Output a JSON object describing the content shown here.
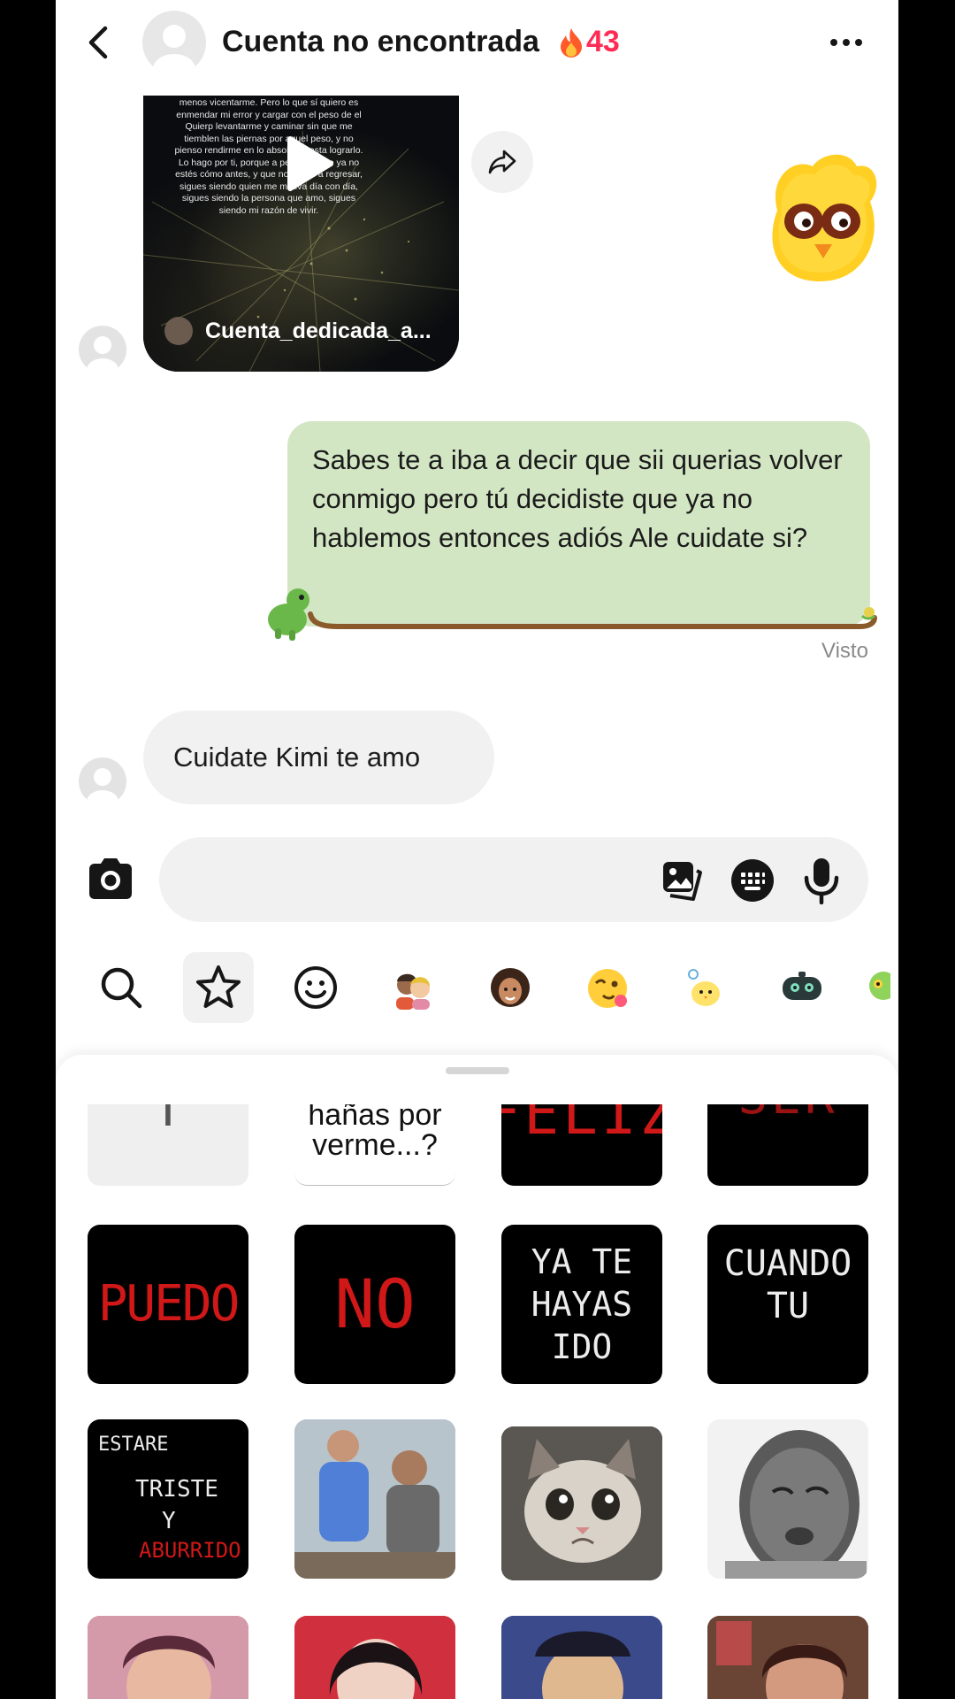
{
  "header": {
    "title": "Cuenta no encontrada",
    "streak_count": "43"
  },
  "video_message": {
    "overlay_text": "menos vicentarme. Pero lo que sí quiero es enmendar mi error y cargar con el peso de el Quierp levantarme y caminar sin que me tiemblen las piernas por aquel peso, y no pienso rendirme en lo absoluto hasta lograrlo. Lo hago por ti, porque a pesar de que ya no estés cómo antes, y que no vayas a regresar, sigues siendo quien me motiva día con día, sigues siendo la persona que amo, sigues siendo mi razón de vivir.",
    "author": "Cuenta_dedicada_a..."
  },
  "messages": {
    "sent_text": "Sabes te a iba a decir que sii querias volver conmigo pero tú decidiste que ya no hablemos entonces adiós Ale cuidate si?",
    "seen_label": "Visto",
    "received_text": "Cuidate Kimi te amo"
  },
  "composer": {
    "placeholder": ""
  },
  "sticker_tabs": [
    {
      "icon": "search-icon"
    },
    {
      "icon": "star-icon"
    },
    {
      "icon": "smiley-icon"
    },
    {
      "icon": "avatar-pair-icon"
    },
    {
      "icon": "curly-avatar-icon"
    },
    {
      "icon": "wink-emoji-icon"
    },
    {
      "icon": "chick-sticker-icon"
    },
    {
      "icon": "robot-sticker-icon"
    },
    {
      "icon": "extra-sticker-icon"
    }
  ],
  "stickers": {
    "row0": [
      "T",
      "hañas por verme...?",
      "FELIZ",
      "SER"
    ],
    "row1": [
      "PUEDO",
      "NO",
      "YA TE HAYAS IDO",
      "CUANDO TU"
    ],
    "row2": {
      "s0_line1": "ESTARE",
      "s0_line2": "TRISTE",
      "s0_line3": "Y",
      "s0_line4": "ABURRIDO"
    }
  },
  "colors": {
    "accent": "#fe2c55",
    "sent_bubble": "#d3e6c3",
    "received_bubble": "#f1f1f2"
  }
}
